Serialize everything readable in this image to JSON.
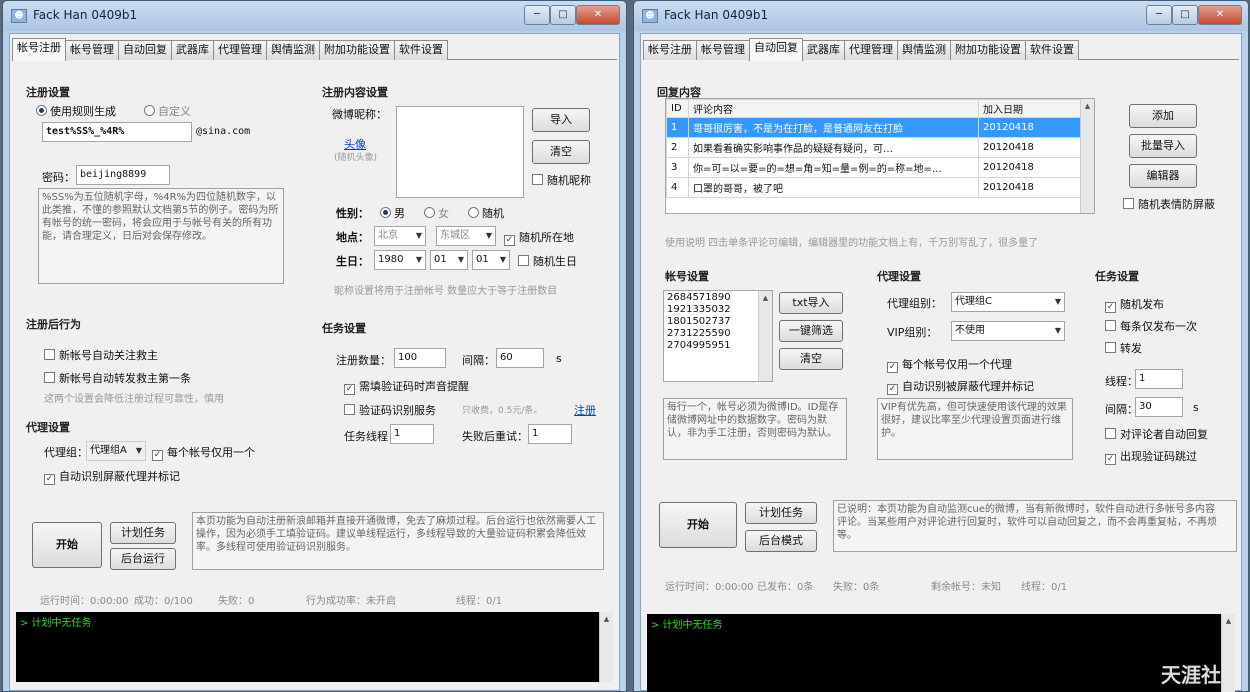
{
  "w1": {
    "title": "Fack Han 0409b1",
    "tabs": [
      "帐号注册",
      "帐号管理",
      "自动回复",
      "武器库",
      "代理管理",
      "舆情监测",
      "附加功能设置",
      "软件设置"
    ],
    "reg": {
      "h": "注册设置",
      "r1": "使用规则生成",
      "r2": "自定义",
      "pattern": "test%SS%_%4R%",
      "domain": "@sina.com",
      "pwd_lbl": "密码：",
      "pwd": "beijing8899",
      "note": "%SS%为五位随机字母，%4R%为四位随机数字，以此类推，不懂的参照默认文档第5节的例子。密码为所有帐号的统一密码，将会应用于与帐号有关的所有功能，请合理定义，日后对会保存修改。"
    },
    "cnt": {
      "h": "注册内容设置",
      "nick": "微博昵称：",
      "head": "头像",
      "head_sub": "(随机头像)",
      "import": "导入",
      "clear": "清空",
      "rnd_nick": "随机昵称",
      "gender": "性别：",
      "male": "男",
      "female": "女",
      "random": "随机",
      "loc": "地点：",
      "city": "北京",
      "district": "东城区",
      "rnd_loc": "随机所在地",
      "bday": "生日：",
      "y": "1980",
      "m": "01",
      "d": "01",
      "rnd_bday": "随机生日",
      "hint": "昵称设置将用于注册帐号 数量应大于等于注册数目"
    },
    "after": {
      "h": "注册后行为",
      "c1": "新帐号自动关注救主",
      "c2": "新帐号自动转发救主第一条",
      "hint": "这两个设置会降低注册过程可靠性，慎用"
    },
    "proxy": {
      "h": "代理设置",
      "grp_lbl": "代理组：",
      "grp": "代理组A",
      "one": "每个帐号仅用一个",
      "auto": "自动识别屏蔽代理并标记"
    },
    "task": {
      "h": "任务设置",
      "count_lbl": "注册数量：",
      "count": "100",
      "gap_lbl": "间隔：",
      "gap": "60",
      "unit": "s",
      "sound": "需填验证码时声音提醒",
      "captcha": "验证码识别服务",
      "captcha_hint": "只收费，0.5元/条。",
      "register": "注册",
      "threads_lbl": "任务线程：",
      "threads": "1",
      "retry_lbl": "失败后重试：",
      "retry": "1"
    },
    "start": "开始",
    "plan": "计划任务",
    "bg": "后台运行",
    "desc": "本页功能为自动注册新浪邮箱并直接开通微博，免去了麻烦过程。后台运行也依然需要人工操作，因为必须手工填验证码。建议单线程运行，多线程导致的大量验证码积累会降低效率。多线程可使用验证码识别服务。",
    "status": [
      "运行时间：0:00:00",
      "成功：0/100",
      "失败：0",
      "行为成功率：未开启",
      "线程：0/1"
    ],
    "log": "> 计划中无任务"
  },
  "w2": {
    "title": "Fack Han 0409b1",
    "tabs": [
      "帐号注册",
      "帐号管理",
      "自动回复",
      "武器库",
      "代理管理",
      "舆情监测",
      "附加功能设置",
      "软件设置"
    ],
    "reply": {
      "h": "回复内容",
      "cols": [
        "ID",
        "评论内容",
        "加入日期"
      ],
      "rows": [
        [
          "1",
          "哥哥很厉害，不是为在打脸，是普通网友在打脸",
          "20120418"
        ],
        [
          "2",
          "如果看着确实影响事作品的疑疑有疑问，可…",
          "20120418"
        ],
        [
          "3",
          "你=可=以=要=的=想=角=知=量=例=的=称=地=…",
          "20120418"
        ],
        [
          "4",
          "口罩的哥哥，被了吧",
          "20120418"
        ]
      ],
      "add": "添加",
      "batch": "批量导入",
      "editor": "编辑器",
      "emoji": "随机表情防屏蔽",
      "hint": "使用说明 四击单条评论可编辑，编辑器里的功能文档上有，千万别写乱了，很多量了"
    },
    "acct": {
      "h": "帐号设置",
      "list": [
        "2684571890",
        "1921335032",
        "1801502737",
        "2731225590",
        "2704995951"
      ],
      "txt": "txt导入",
      "pick": "一键筛选",
      "clear": "清空",
      "note": "每行一个，帐号必须为微博ID。ID是存储微博网址中的数据数字。密码为默认，非为手工注册，否则密码为默认。"
    },
    "proxy": {
      "h": "代理设置",
      "grp_lbl": "代理组别：",
      "grp": "代理组C",
      "vip_lbl": "VIP组别：",
      "vip": "不使用",
      "one": "每个帐号仅用一个代理",
      "auto": "自动识别被屏蔽代理并标记",
      "note": "VIP有优先高，但可快速使用该代理的效果很好，建议比率至少代理设置页面进行维护。"
    },
    "task": {
      "h": "任务设置",
      "c1": "随机发布",
      "c2": "每条仅发布一次",
      "c3": "转发",
      "threads_lbl": "线程：",
      "threads": "1",
      "gap_lbl": "间隔：",
      "gap": "30",
      "unit": "s",
      "c4": "对评论者自动回复",
      "c5": "出现验证码跳过"
    },
    "start": "开始",
    "plan": "计划任务",
    "bg": "后台模式",
    "desc": "已说明：本页功能为自动监测cue的微博，当有新微博时，软件自动进行多帐号多内容评论。当某些用户对评论进行回复时，软件可以自动回复之，而不会再重复帖，不再烦等。",
    "status": [
      "运行时间：0:00:00",
      "已发布：0条",
      "失败：0条",
      "剩余帐号：未知",
      "线程：0/1"
    ],
    "log": "> 计划中无任务",
    "watermark": "天涯社"
  }
}
